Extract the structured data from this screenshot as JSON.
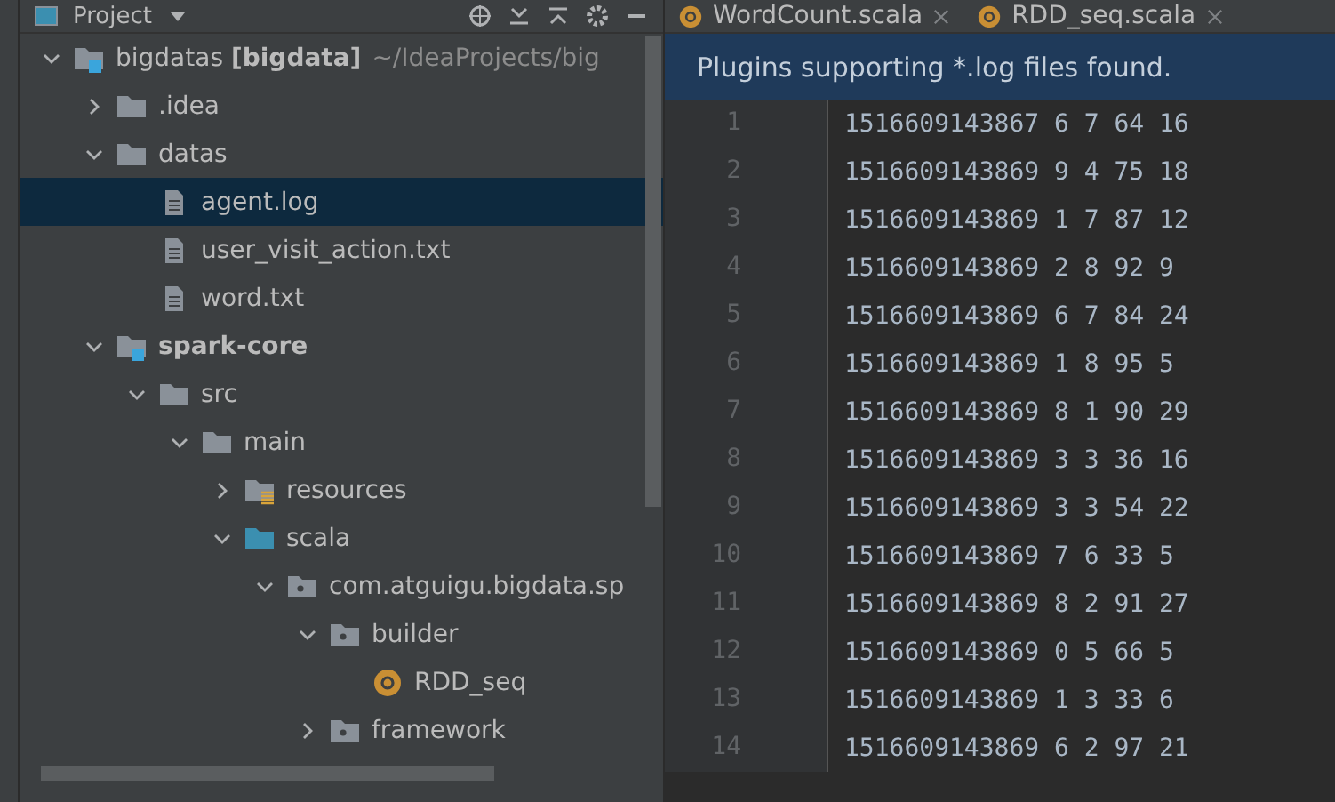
{
  "project_panel": {
    "title": "Project",
    "tree": [
      {
        "kind": "root",
        "label": "bigdatas",
        "module": "[bigdata]",
        "path": "~/IdeaProjects/big",
        "expanded": true,
        "selected": false,
        "children": [
          {
            "kind": "folder",
            "label": ".idea",
            "expanded": false,
            "selected": false
          },
          {
            "kind": "folder",
            "label": "datas",
            "expanded": true,
            "selected": false,
            "children": [
              {
                "kind": "file",
                "label": "agent.log",
                "selected": true
              },
              {
                "kind": "file",
                "label": "user_visit_action.txt",
                "selected": false
              },
              {
                "kind": "file",
                "label": "word.txt",
                "selected": false
              }
            ]
          },
          {
            "kind": "module",
            "label": "spark-core",
            "expanded": true,
            "selected": false,
            "children": [
              {
                "kind": "folder",
                "label": "src",
                "expanded": true,
                "selected": false,
                "children": [
                  {
                    "kind": "folder",
                    "label": "main",
                    "expanded": true,
                    "selected": false,
                    "children": [
                      {
                        "kind": "resources",
                        "label": "resources",
                        "expanded": false,
                        "selected": false
                      },
                      {
                        "kind": "source",
                        "label": "scala",
                        "expanded": true,
                        "selected": false,
                        "children": [
                          {
                            "kind": "package",
                            "label": "com.atguigu.bigdata.sp",
                            "expanded": true,
                            "selected": false,
                            "children": [
                              {
                                "kind": "package",
                                "label": "builder",
                                "expanded": true,
                                "selected": false,
                                "children": [
                                  {
                                    "kind": "class",
                                    "label": "RDD_seq",
                                    "selected": false
                                  }
                                ]
                              },
                              {
                                "kind": "package",
                                "label": "framework",
                                "expanded": false,
                                "selected": false
                              }
                            ]
                          }
                        ]
                      }
                    ]
                  }
                ]
              }
            ]
          }
        ]
      }
    ]
  },
  "editor": {
    "tabs": [
      {
        "label": "WordCount.scala"
      },
      {
        "label": "RDD_seq.scala"
      }
    ],
    "banner": "Plugins supporting *.log files found.",
    "lines": [
      {
        "number": "1",
        "text": "1516609143867 6 7 64 16"
      },
      {
        "number": "2",
        "text": "1516609143869 9 4 75 18"
      },
      {
        "number": "3",
        "text": "1516609143869 1 7 87 12"
      },
      {
        "number": "4",
        "text": "1516609143869 2 8 92 9"
      },
      {
        "number": "5",
        "text": "1516609143869 6 7 84 24"
      },
      {
        "number": "6",
        "text": "1516609143869 1 8 95 5"
      },
      {
        "number": "7",
        "text": "1516609143869 8 1 90 29"
      },
      {
        "number": "8",
        "text": "1516609143869 3 3 36 16"
      },
      {
        "number": "9",
        "text": "1516609143869 3 3 54 22"
      },
      {
        "number": "10",
        "text": "1516609143869 7 6 33 5"
      },
      {
        "number": "11",
        "text": "1516609143869 8 2 91 27"
      },
      {
        "number": "12",
        "text": "1516609143869 0 5 66 5"
      },
      {
        "number": "13",
        "text": "1516609143869 1 3 33 6"
      },
      {
        "number": "14",
        "text": "1516609143869 6 2 97 21"
      }
    ]
  }
}
